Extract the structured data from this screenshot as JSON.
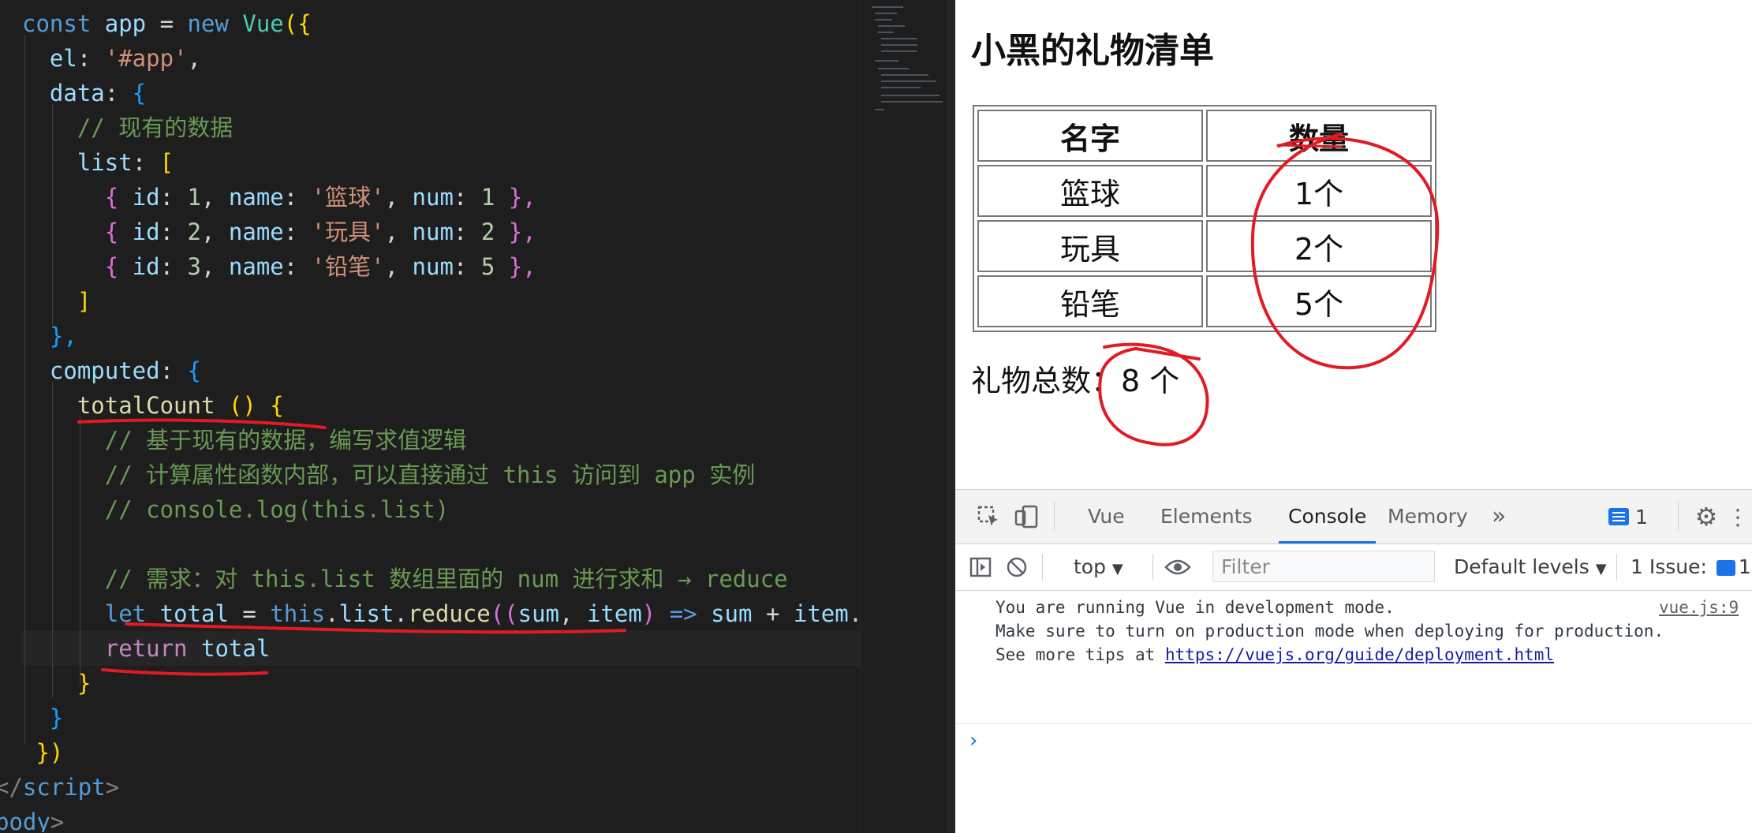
{
  "editor": {
    "lines": [
      {
        "segments": [
          {
            "t": "const ",
            "c": "kw"
          },
          {
            "t": "app",
            "c": "var"
          },
          {
            "t": " = ",
            "c": "pun"
          },
          {
            "t": "new ",
            "c": "kw"
          },
          {
            "t": "Vue",
            "c": "cls"
          },
          {
            "t": "({",
            "c": "br1"
          }
        ]
      },
      {
        "segments": [
          {
            "t": "  el",
            "c": "var"
          },
          {
            "t": ": ",
            "c": "pun"
          },
          {
            "t": "'#app'",
            "c": "str"
          },
          {
            "t": ",",
            "c": "pun"
          }
        ]
      },
      {
        "segments": [
          {
            "t": "  data",
            "c": "var"
          },
          {
            "t": ": ",
            "c": "pun"
          },
          {
            "t": "{",
            "c": "br3"
          }
        ]
      },
      {
        "segments": [
          {
            "t": "    // 现有的数据",
            "c": "cmt"
          }
        ]
      },
      {
        "segments": [
          {
            "t": "    list",
            "c": "var"
          },
          {
            "t": ": ",
            "c": "pun"
          },
          {
            "t": "[",
            "c": "br1"
          }
        ]
      },
      {
        "segments": [
          {
            "t": "      { ",
            "c": "br2"
          },
          {
            "t": "id",
            "c": "var"
          },
          {
            "t": ": ",
            "c": "pun"
          },
          {
            "t": "1",
            "c": "num"
          },
          {
            "t": ", ",
            "c": "pun"
          },
          {
            "t": "name",
            "c": "var"
          },
          {
            "t": ": ",
            "c": "pun"
          },
          {
            "t": "'篮球'",
            "c": "str"
          },
          {
            "t": ", ",
            "c": "pun"
          },
          {
            "t": "num",
            "c": "var"
          },
          {
            "t": ": ",
            "c": "pun"
          },
          {
            "t": "1",
            "c": "num"
          },
          {
            "t": " },",
            "c": "br2"
          }
        ]
      },
      {
        "segments": [
          {
            "t": "      { ",
            "c": "br2"
          },
          {
            "t": "id",
            "c": "var"
          },
          {
            "t": ": ",
            "c": "pun"
          },
          {
            "t": "2",
            "c": "num"
          },
          {
            "t": ", ",
            "c": "pun"
          },
          {
            "t": "name",
            "c": "var"
          },
          {
            "t": ": ",
            "c": "pun"
          },
          {
            "t": "'玩具'",
            "c": "str"
          },
          {
            "t": ", ",
            "c": "pun"
          },
          {
            "t": "num",
            "c": "var"
          },
          {
            "t": ": ",
            "c": "pun"
          },
          {
            "t": "2",
            "c": "num"
          },
          {
            "t": " },",
            "c": "br2"
          }
        ]
      },
      {
        "segments": [
          {
            "t": "      { ",
            "c": "br2"
          },
          {
            "t": "id",
            "c": "var"
          },
          {
            "t": ": ",
            "c": "pun"
          },
          {
            "t": "3",
            "c": "num"
          },
          {
            "t": ", ",
            "c": "pun"
          },
          {
            "t": "name",
            "c": "var"
          },
          {
            "t": ": ",
            "c": "pun"
          },
          {
            "t": "'铅笔'",
            "c": "str"
          },
          {
            "t": ", ",
            "c": "pun"
          },
          {
            "t": "num",
            "c": "var"
          },
          {
            "t": ": ",
            "c": "pun"
          },
          {
            "t": "5",
            "c": "num"
          },
          {
            "t": " },",
            "c": "br2"
          }
        ]
      },
      {
        "segments": [
          {
            "t": "    ]",
            "c": "br1"
          }
        ]
      },
      {
        "segments": [
          {
            "t": "  },",
            "c": "br3"
          }
        ]
      },
      {
        "segments": [
          {
            "t": "  computed",
            "c": "var"
          },
          {
            "t": ": ",
            "c": "pun"
          },
          {
            "t": "{",
            "c": "br3"
          }
        ]
      },
      {
        "segments": [
          {
            "t": "    totalCount ",
            "c": "fn"
          },
          {
            "t": "() {",
            "c": "br1"
          }
        ]
      },
      {
        "segments": [
          {
            "t": "      // 基于现有的数据，编写求值逻辑",
            "c": "cmt"
          }
        ]
      },
      {
        "segments": [
          {
            "t": "      // 计算属性函数内部，可以直接通过 this 访问到 app 实例",
            "c": "cmt"
          }
        ]
      },
      {
        "segments": [
          {
            "t": "      // console.log(this.list)",
            "c": "cmt"
          }
        ]
      },
      {
        "segments": [
          {
            "t": "",
            "c": "pun"
          }
        ]
      },
      {
        "segments": [
          {
            "t": "      // 需求：对 this.list 数组里面的 num 进行求和 → reduce",
            "c": "cmt"
          }
        ]
      },
      {
        "segments": [
          {
            "t": "      let ",
            "c": "kw"
          },
          {
            "t": "total",
            "c": "var"
          },
          {
            "t": " = ",
            "c": "pun"
          },
          {
            "t": "this",
            "c": "kw"
          },
          {
            "t": ".",
            "c": "pun"
          },
          {
            "t": "list",
            "c": "var"
          },
          {
            "t": ".",
            "c": "pun"
          },
          {
            "t": "reduce",
            "c": "fn"
          },
          {
            "t": "((",
            "c": "br2"
          },
          {
            "t": "sum",
            "c": "var"
          },
          {
            "t": ", ",
            "c": "pun"
          },
          {
            "t": "item",
            "c": "var"
          },
          {
            "t": ")",
            "c": "br2"
          },
          {
            "t": " => ",
            "c": "kw"
          },
          {
            "t": "sum",
            "c": "var"
          },
          {
            "t": " + ",
            "c": "pun"
          },
          {
            "t": "item",
            "c": "var"
          },
          {
            "t": ".",
            "c": "pun"
          }
        ]
      },
      {
        "segments": [
          {
            "t": "      return ",
            "c": "kw2"
          },
          {
            "t": "total",
            "c": "var"
          }
        ]
      },
      {
        "segments": [
          {
            "t": "    }",
            "c": "br1"
          }
        ]
      },
      {
        "segments": [
          {
            "t": "  }",
            "c": "br3"
          }
        ]
      },
      {
        "segments": [
          {
            "t": " })",
            "c": "br1"
          }
        ]
      },
      {
        "segments": [
          {
            "t": "</",
            "c": "tag"
          },
          {
            "t": "script",
            "c": "tagn"
          },
          {
            "t": ">",
            "c": "tag"
          }
        ]
      },
      {
        "segments": [
          {
            "t": "body",
            "c": "tagn"
          },
          {
            "t": ">",
            "c": "tag"
          }
        ]
      }
    ]
  },
  "page": {
    "title": "小黑的礼物清单",
    "table": {
      "headers": [
        "名字",
        "数量"
      ],
      "rows": [
        [
          "篮球",
          "1个"
        ],
        [
          "玩具",
          "2个"
        ],
        [
          "铅笔",
          "5个"
        ]
      ]
    },
    "total_label": "礼物总数：",
    "total_value": "8 个"
  },
  "devtools": {
    "tabs": [
      "Vue",
      "Elements",
      "Console",
      "Memory"
    ],
    "active_tab": "Console",
    "more_label": "»",
    "issues_badge_count": "1",
    "context_select": "top",
    "filter_placeholder": "Filter",
    "levels_select": "Default levels",
    "issues_button": "1 Issue:",
    "issues_button_count": "1",
    "console_lines": [
      "You are running Vue in development mode.",
      "Make sure to turn on production mode when deploying for production.",
      "See more tips at "
    ],
    "console_link": "https://vuejs.org/guide/deployment.html",
    "log_source": "vue.js:9",
    "prompt_symbol": "›"
  },
  "colors": {
    "annotation": "#e01b24",
    "editor_bg": "#1e1e1e",
    "devtools_accent": "#1a73e8"
  }
}
